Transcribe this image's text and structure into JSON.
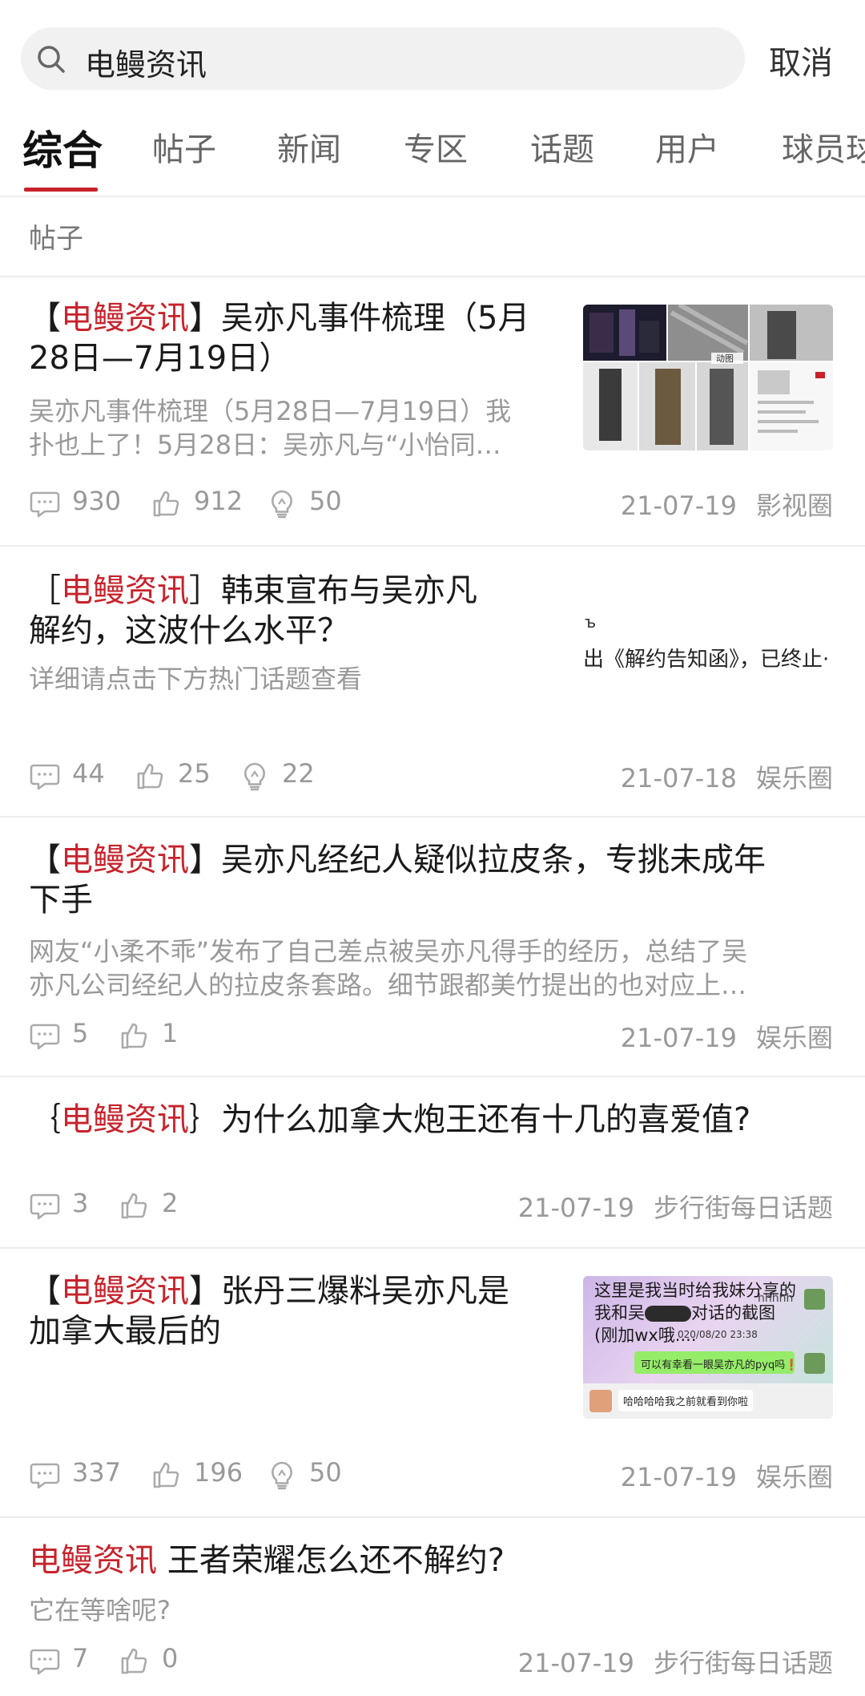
{
  "search": {
    "query": "电鳗资讯",
    "cancel_label": "取消"
  },
  "tabs": [
    {
      "label": "综合"
    },
    {
      "label": "帖子"
    },
    {
      "label": "新闻"
    },
    {
      "label": "专区"
    },
    {
      "label": "话题"
    },
    {
      "label": "用户"
    },
    {
      "label": "球员球"
    }
  ],
  "section": {
    "label": "帖子"
  },
  "posts": [
    {
      "tag_open": "【",
      "tag": "电鳗资讯",
      "tag_close": "】",
      "title_line1": "吴亦凡事件梳理（5月",
      "title_line2": "28日—7月19日）",
      "excerpt_line1": "吴亦凡事件梳理（5月28日—7月19日）我",
      "excerpt_line2": "扑也上了！5月28日：吴亦凡与“小怡同…",
      "comments": "930",
      "likes": "912",
      "lights": "50",
      "date": "21-07-19",
      "circle": "影视圈",
      "thumb_label": "动图"
    },
    {
      "tag_open": "［",
      "tag": "电鳗资讯",
      "tag_close": "］",
      "title_line1": "韩束宣布与吴亦凡",
      "title_line2": "解约，这波什么水平？",
      "excerpt_line1": "详细请点击下方热门话题查看",
      "comments": "44",
      "likes": "25",
      "lights": "22",
      "date": "21-07-18",
      "circle": "娱乐圈",
      "thumb_text": "出《解约告知函》，已终止·",
      "thumb_mark": "ъ"
    },
    {
      "tag_open": "【",
      "tag": "电鳗资讯",
      "tag_close": "】",
      "title_line1": "吴亦凡经纪人疑似拉皮条，专挑未成年",
      "title_line2": "下手",
      "excerpt_line1": "网友“小柔不乖”发布了自己差点被吴亦凡得手的经历，总结了吴",
      "excerpt_line2": "亦凡公司经纪人的拉皮条套路。细节跟都美竹提出的也对应上…",
      "comments": "5",
      "likes": "1",
      "date": "21-07-19",
      "circle": "娱乐圈"
    },
    {
      "tag_open": "｛",
      "tag": "电鳗资讯",
      "tag_close": "｝",
      "title_line1": "为什么加拿大炮王还有十几的喜爱值?",
      "comments": "3",
      "likes": "2",
      "date": "21-07-19",
      "circle": "步行街每日话题"
    },
    {
      "tag_open": "【",
      "tag": "电鳗资讯",
      "tag_close": "】",
      "title_line1": "张丹三爆料吴亦凡是",
      "title_line2": "加拿大最后的",
      "comments": "337",
      "likes": "196",
      "lights": "50",
      "date": "21-07-19",
      "circle": "娱乐圈",
      "chat": {
        "line1": "这里是我当时给我妹分享的",
        "line2a": "我和吴",
        "line2b": "对话的截图",
        "line3": "(刚加wx哦....",
        "hhh": "hhhhh",
        "timestamp": "020/08/20 23:38",
        "bubble1": "可以有幸看一眼吴亦凡的pyq吗❗",
        "bubble2": "哈哈哈哈我之前就看到你啦"
      }
    },
    {
      "tag": "电鳗资讯",
      "title_line1": "王者荣耀怎么还不解约?",
      "excerpt_line1": "它在等啥呢?",
      "comments": "7",
      "likes": "0",
      "date": "21-07-19",
      "circle": "步行街每日话题"
    }
  ]
}
